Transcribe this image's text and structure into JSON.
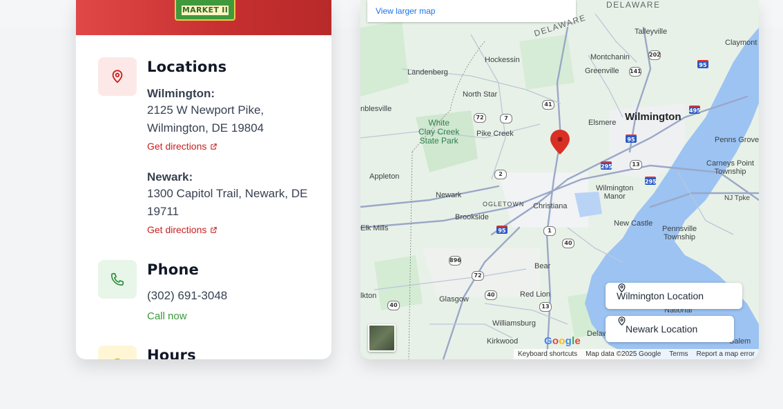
{
  "logo": {
    "text": "MARKET II"
  },
  "locations": {
    "title": "Locations",
    "items": [
      {
        "city": "Wilmington:",
        "address": "2125 W Newport Pike, Wilmington, DE 19804",
        "link": "Get directions"
      },
      {
        "city": "Newark:",
        "address": "1300 Capitol Trail, Newark, DE 19711",
        "link": "Get directions"
      }
    ]
  },
  "phone": {
    "title": "Phone",
    "number": "(302) 691-3048",
    "action": "Call now"
  },
  "hours": {
    "title": "Hours"
  },
  "map": {
    "larger_map": "View larger map",
    "buttons": {
      "wilmington": "Wilmington Location",
      "newark": "Newark Location"
    },
    "labels": {
      "delaware_top": "DELAWARE",
      "delaware_diag": "DELAWARE",
      "talleyville": "Talleyville",
      "claymont": "Claymont",
      "hockessin": "Hockessin",
      "montchanin": "Montchanin",
      "greenville": "Greenville",
      "landenberg": "Landenberg",
      "north_star": "North Star",
      "nblesville": "nblesville",
      "wilmington": "Wilmington",
      "elsmere": "Elsmere",
      "white_clay": "White\nClay Creek\nState Park",
      "pike_creek": "Pike Creek",
      "penns_grove": "Penns Grove",
      "carneys_point": "Carneys Point\nTownship",
      "appleton": "Appleton",
      "newark": "Newark",
      "ogletown": "OGLETOWN",
      "wilmington_manor": "Wilmington\nManor",
      "nj_tpke": "NJ Tpke",
      "christiana": "Christiana",
      "brookside": "Brookside",
      "elk_mills": "Elk Mills",
      "new_castle": "New Castle",
      "pennsville": "Pennsville\nTownship",
      "bear": "Bear",
      "red_lion": "Red Lion",
      "glasgow": "Glasgow",
      "lkton": "lkton",
      "national": "National",
      "williamsburg": "Williamsburg",
      "kirkwood": "Kirkwood",
      "delaw": "Delaw",
      "salem": "Salem"
    },
    "shields": {
      "s202": "202",
      "s95a": "95",
      "s141": "141",
      "s41": "41",
      "s72a": "72",
      "s7": "7",
      "s495": "495",
      "s95b": "95",
      "s295a": "295",
      "s13a": "13",
      "s295b": "295",
      "s2": "2",
      "s95c": "95",
      "s1": "1",
      "s40a": "40",
      "s896": "896",
      "s72b": "72",
      "s40b": "40",
      "s13b": "13",
      "s40c": "40"
    },
    "google": "Google",
    "attribution": [
      "Keyboard shortcuts",
      "Map data ©2025 Google",
      "Terms",
      "Report a map error"
    ]
  },
  "colors": {
    "accent_red": "#c81e1e",
    "green": "#3a9a3a",
    "map_water": "#8ab4f8"
  }
}
